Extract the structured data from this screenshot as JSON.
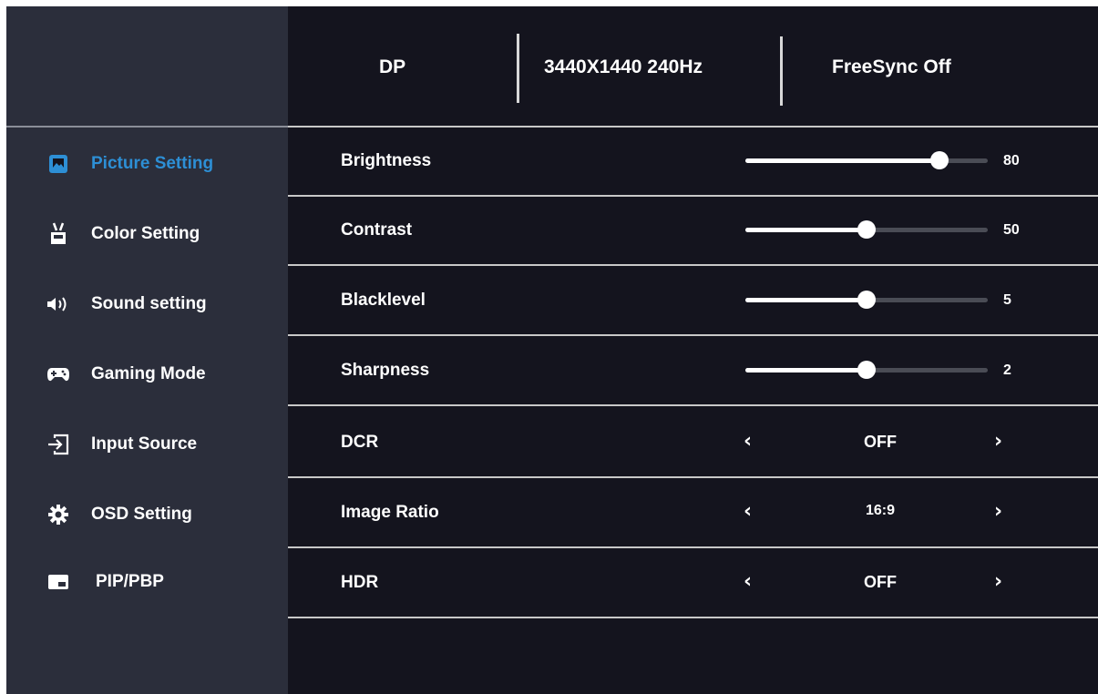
{
  "header": {
    "input": "DP",
    "resolution": "3440X1440 240Hz",
    "freesync": "FreeSync Off"
  },
  "sidebar": {
    "active_color": "#2d8fd5",
    "items": [
      {
        "label": "Picture Setting",
        "icon": "picture-icon",
        "active": true
      },
      {
        "label": "Color Setting",
        "icon": "color-icon",
        "active": false
      },
      {
        "label": "Sound setting",
        "icon": "speaker-icon",
        "active": false
      },
      {
        "label": "Gaming Mode",
        "icon": "gamepad-icon",
        "active": false
      },
      {
        "label": "Input Source",
        "icon": "input-source-icon",
        "active": false
      },
      {
        "label": "OSD Setting",
        "icon": "gear-icon",
        "active": false
      },
      {
        "label": "PIP/PBP",
        "icon": "pip-icon",
        "active": false
      }
    ]
  },
  "settings": {
    "sliders": [
      {
        "label": "Brightness",
        "value": "80",
        "level": 0.8
      },
      {
        "label": "Contrast",
        "value": "50",
        "level": 0.5
      },
      {
        "label": "Blacklevel",
        "value": "5",
        "level": 0.5
      },
      {
        "label": "Sharpness",
        "value": "2",
        "level": 0.5
      }
    ],
    "options": [
      {
        "label": "DCR",
        "value": "OFF"
      },
      {
        "label": "Image Ratio",
        "value": "16:9"
      },
      {
        "label": "HDR",
        "value": "OFF"
      }
    ],
    "arrow_left": "‹",
    "arrow_right": "›"
  }
}
